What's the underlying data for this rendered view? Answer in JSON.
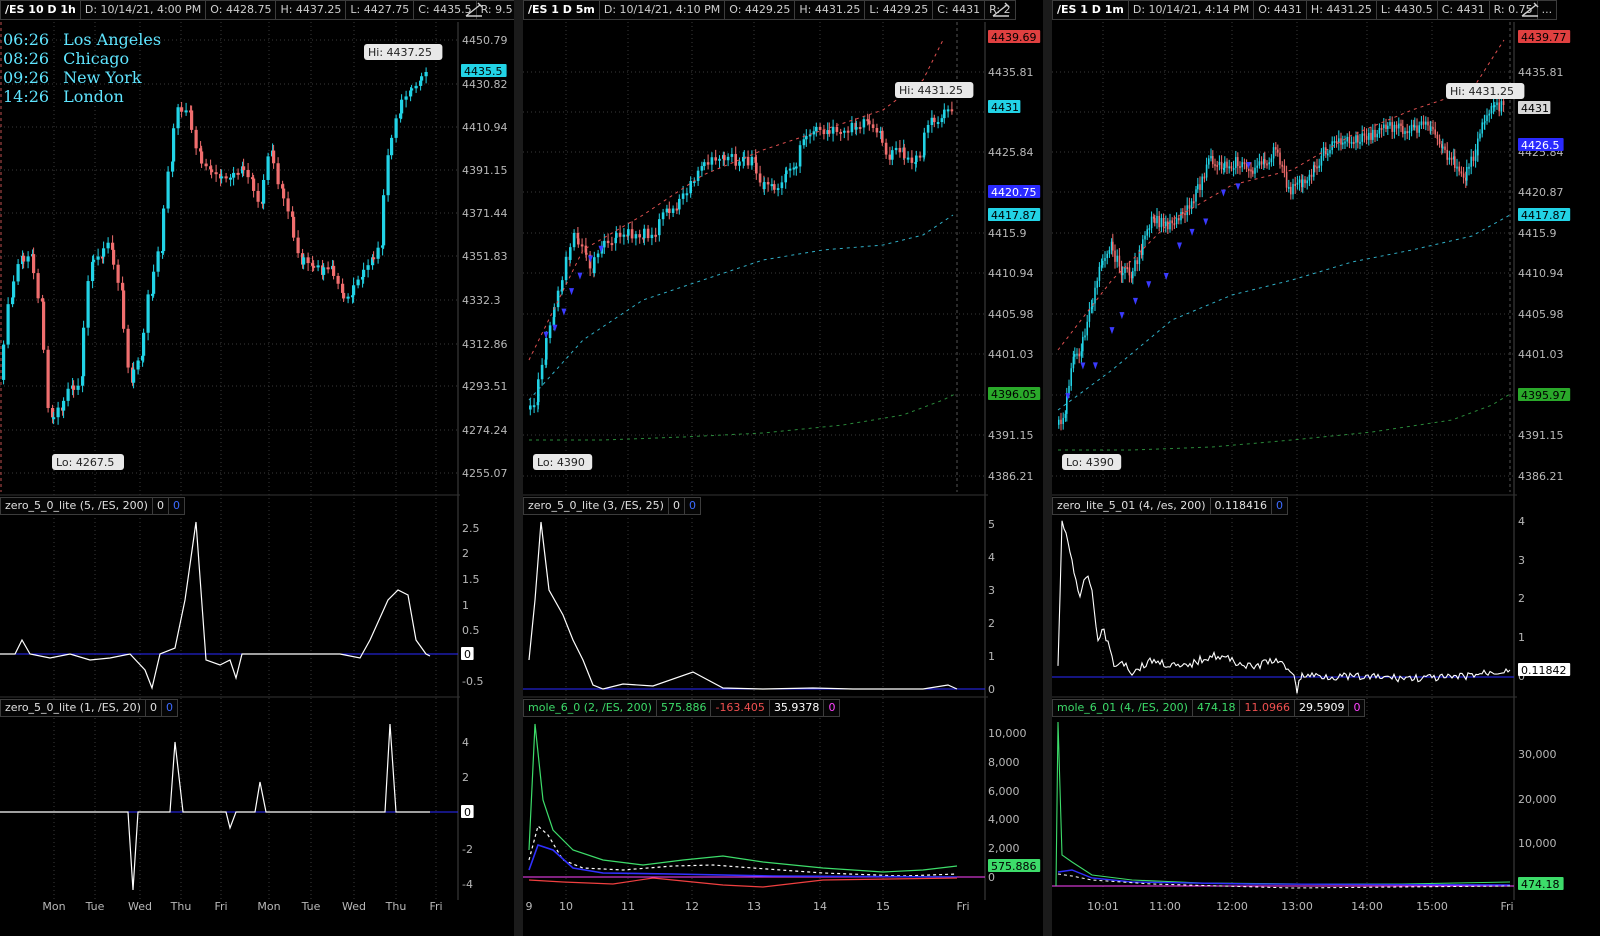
{
  "panels": [
    {
      "symbol": "/ES 10 D 1h",
      "date": "D: 10/14/21, 4:00 PM",
      "open": "O: 4428.75",
      "high": "H: 4437.25",
      "low": "L: 4427.75",
      "close": "C: 4435.5",
      "range": "R: 9.5",
      "price_axis": [
        "4450.79",
        "4430.82",
        "4410.94",
        "4391.15",
        "4371.44",
        "4351.83",
        "4332.3",
        "4312.86",
        "4293.51",
        "4274.24",
        "4255.07"
      ],
      "last_price": "4435.5",
      "hi_label": "Hi: 4437.25",
      "lo_label": "Lo: 4267.5",
      "time_axis": [
        "Mon",
        "Tue",
        "Wed",
        "Thu",
        "Fri",
        "Mon",
        "Tue",
        "Wed",
        "Thu",
        "Fri"
      ],
      "study1": {
        "name": "zero_5_0_lite (5, /ES, 200)",
        "v1": "0",
        "v2": "0",
        "axis": [
          "2.5",
          "2",
          "1.5",
          "1",
          "0.5",
          "-0.5"
        ],
        "last": "0"
      },
      "study2": {
        "name": "zero_5_0_lite (1, /ES, 20)",
        "v1": "0",
        "v2": "0",
        "axis": [
          "4",
          "2",
          "-2",
          "-4"
        ],
        "last": "0"
      }
    },
    {
      "symbol": "/ES 1 D 5m",
      "date": "D: 10/14/21, 4:10 PM",
      "open": "O: 4429.25",
      "high": "H: 4431.25",
      "low": "L: 4429.25",
      "close": "C: 4431",
      "range": "R: 2",
      "price_axis": [
        "4435.81",
        "4425.84",
        "4415.9",
        "4410.94",
        "4405.98",
        "4401.03",
        "4391.15",
        "4386.21"
      ],
      "badges": [
        "4439.69",
        "4431",
        "4420.75",
        "4417.87",
        "4396.05"
      ],
      "hi_label": "Hi: 4431.25",
      "lo_label": "Lo: 4390",
      "time_axis": [
        "9",
        "10",
        "11",
        "12",
        "13",
        "14",
        "15",
        "Fri"
      ],
      "study1": {
        "name": "zero_5_0_lite (3, /ES, 25)",
        "v1": "0",
        "v2": "0",
        "axis": [
          "5",
          "4",
          "3",
          "2",
          "1",
          "0"
        ]
      },
      "study2": {
        "name": "mole_6_0 (2, /ES, 200)",
        "v1": "575.886",
        "v2": "-163.405",
        "v3": "35.9378",
        "v4": "0",
        "axis": [
          "10,000",
          "8,000",
          "6,000",
          "4,000",
          "2,000",
          "0"
        ],
        "last": "575.886"
      }
    },
    {
      "symbol": "/ES 1 D 1m",
      "date": "D: 10/14/21, 4:14 PM",
      "open": "O: 4431",
      "high": "H: 4431.25",
      "low": "L: 4430.5",
      "close": "C: 4431",
      "range": "R: 0.75",
      "more": "...",
      "price_axis": [
        "4435.81",
        "4425.84",
        "4420.87",
        "4415.9",
        "4410.94",
        "4405.98",
        "4401.03",
        "4391.15",
        "4386.21"
      ],
      "badges": [
        "4439.77",
        "4431",
        "4426.5",
        "4417.87",
        "4395.97"
      ],
      "hi_label": "Hi: 4431.25",
      "lo_label": "Lo: 4390",
      "time_axis": [
        "10:01",
        "11:00",
        "12:00",
        "13:00",
        "14:00",
        "15:00",
        "Fri"
      ],
      "study1": {
        "name": "zero_lite_5_01 (4, /es, 200)",
        "v1": "0.118416",
        "v2": "0",
        "axis": [
          "4",
          "3",
          "2",
          "1",
          "0"
        ],
        "last": "0.11842"
      },
      "study2": {
        "name": "mole_6_01 (4, /ES, 200)",
        "v1": "474.18",
        "v2": "11.0966",
        "v3": "29.5909",
        "v4": "0",
        "axis": [
          "30,000",
          "20,000",
          "10,000",
          "0"
        ],
        "last": "474.18"
      }
    }
  ],
  "clock": [
    {
      "time": "06:26",
      "city": "Los Angeles"
    },
    {
      "time": "08:26",
      "city": "Chicago"
    },
    {
      "time": "09:26",
      "city": "New York"
    },
    {
      "time": "14:26",
      "city": "London"
    }
  ],
  "colors": {
    "up": "#22d3e6",
    "down": "#f06e6e",
    "axis_text": "#b8b8b8",
    "grid": "#3a3a3a",
    "zero_line": "#2a2aff"
  }
}
